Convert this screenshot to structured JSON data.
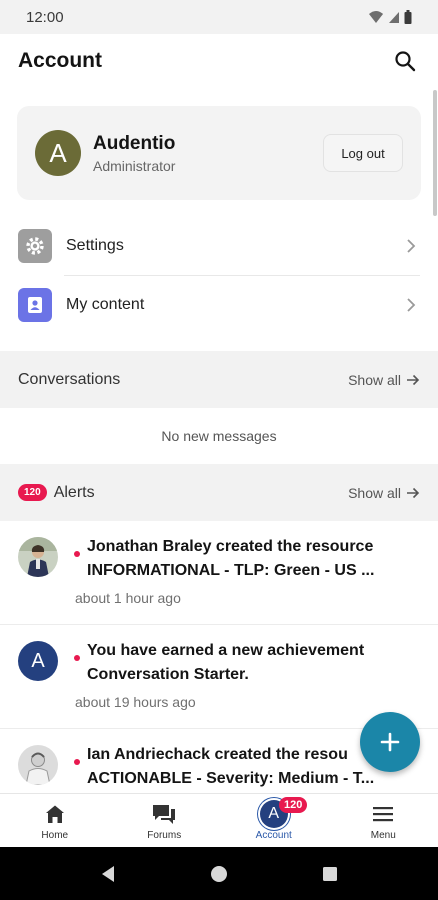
{
  "status_bar": {
    "time": "12:00"
  },
  "header": {
    "title": "Account"
  },
  "profile": {
    "avatar_letter": "A",
    "name": "Audentio",
    "role": "Administrator",
    "logout_label": "Log out"
  },
  "menu": [
    {
      "label": "Settings",
      "icon": "gear-icon"
    },
    {
      "label": "My content",
      "icon": "user-card-icon"
    }
  ],
  "conversations": {
    "title": "Conversations",
    "show_all": "Show all",
    "empty_text": "No new messages"
  },
  "alerts": {
    "count": "120",
    "title": "Alerts",
    "show_all": "Show all",
    "items": [
      {
        "line1": "Jonathan Braley created the resource",
        "line2": "INFORMATIONAL - TLP: Green - US ...",
        "time": "about 1 hour ago"
      },
      {
        "avatar_letter": "A",
        "line1": "You have earned a new achievement",
        "line2": "Conversation Starter.",
        "time": "about 19 hours ago"
      },
      {
        "line1": "Ian Andriechack created the resou",
        "line2": "ACTIONABLE - Severity: Medium - T..."
      }
    ]
  },
  "bottom_nav": [
    {
      "label": "Home",
      "icon": "home-icon"
    },
    {
      "label": "Forums",
      "icon": "chat-bubbles-icon"
    },
    {
      "label": "Account",
      "avatar_letter": "A",
      "badge": "120",
      "active": true
    },
    {
      "label": "Menu",
      "icon": "hamburger-icon"
    }
  ],
  "colors": {
    "accent": "#1b86a8",
    "badge": "#e8194f",
    "active_nav": "#2a58a8",
    "avatar_olive": "#6b6b37",
    "avatar_blue": "#24407f",
    "my_content_icon": "#6b73e6",
    "settings_icon": "#9e9e9e"
  }
}
